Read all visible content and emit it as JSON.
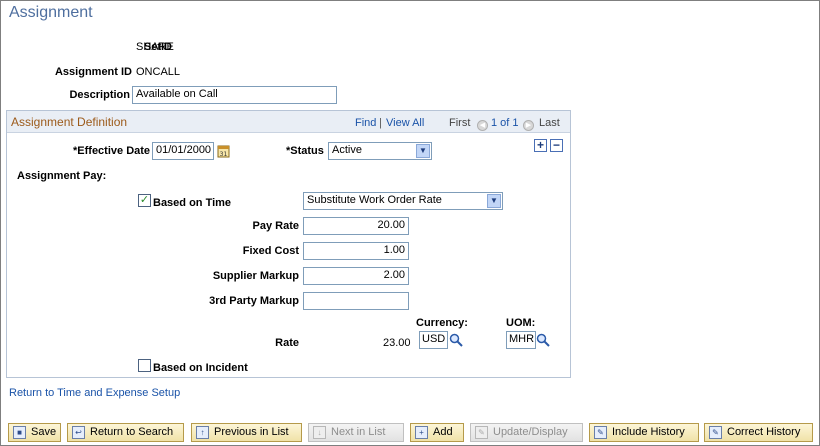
{
  "page": {
    "title": "Assignment"
  },
  "header_fields": {
    "setid_label": "SetID",
    "setid_value": "SHARE",
    "assignment_id_label": "Assignment ID",
    "assignment_id_value": "ONCALL",
    "description_label": "Description",
    "description_value": "Available on Call"
  },
  "group": {
    "title": "Assignment Definition",
    "find": "Find",
    "separator": "|",
    "view_all": "View All",
    "first": "First",
    "position": "1 of 1",
    "last": "Last"
  },
  "definition": {
    "effective_date_label": "*Effective Date",
    "effective_date_value": "01/01/2000",
    "status_label": "*Status",
    "status_value": "Active",
    "assignment_pay_label": "Assignment Pay:",
    "based_on_time_label": "Based on Time",
    "based_on_time_checked": true,
    "rate_type_value": "Substitute Work Order Rate",
    "pay_rate_label": "Pay Rate",
    "pay_rate_value": "20.00",
    "fixed_cost_label": "Fixed Cost",
    "fixed_cost_value": "1.00",
    "supplier_markup_label": "Supplier Markup",
    "supplier_markup_value": "2.00",
    "third_party_markup_label": "3rd Party Markup",
    "third_party_markup_value": "",
    "currency_label": "Currency:",
    "uom_label": "UOM:",
    "rate_label": "Rate",
    "rate_value": "23.00",
    "currency_value": "USD",
    "uom_value": "MHR",
    "based_on_incident_label": "Based on Incident",
    "based_on_incident_checked": false
  },
  "return_link": "Return to Time and Expense Setup",
  "toolbar": {
    "save": "Save",
    "return_to_search": "Return to Search",
    "previous_in_list": "Previous in List",
    "next_in_list": "Next in List",
    "add": "Add",
    "update_display": "Update/Display",
    "include_history": "Include History",
    "correct_history": "Correct History"
  },
  "colors": {
    "title": "#4f6f9f",
    "group_title": "#9c5a1a",
    "link": "#1a53a8"
  }
}
